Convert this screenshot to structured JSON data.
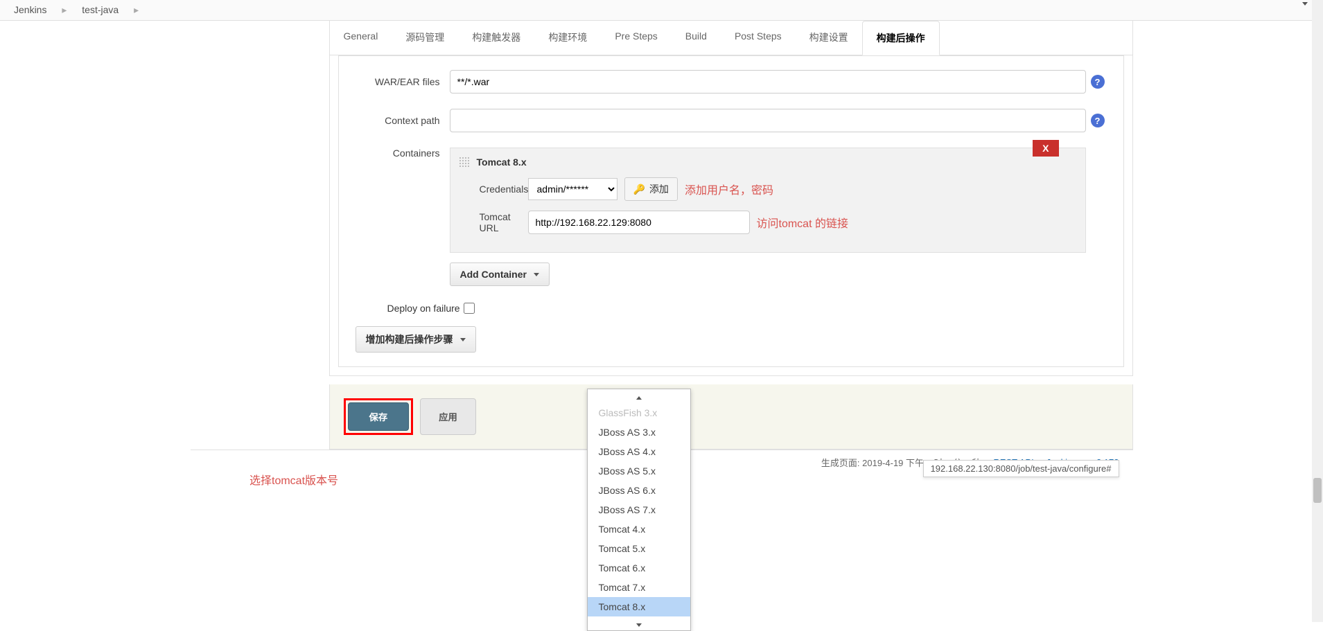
{
  "breadcrumb": {
    "root": "Jenkins",
    "job": "test-java"
  },
  "tabs": [
    "General",
    "源码管理",
    "构建触发器",
    "构建环境",
    "Pre Steps",
    "Build",
    "Post Steps",
    "构建设置",
    "构建后操作"
  ],
  "activeTab": "构建后操作",
  "form": {
    "warFilesLabel": "WAR/EAR files",
    "warFilesValue": "**/*.war",
    "contextPathLabel": "Context path",
    "contextPathValue": "",
    "containersLabel": "Containers",
    "containerTitle": "Tomcat 8.x",
    "closeLabel": "X",
    "credentialsLabel": "Credentials",
    "credentialsValue": "admin/******",
    "addCredBtn": "添加",
    "credNote": "添加用户名，密码",
    "tomcatUrlLabel": "Tomcat URL",
    "tomcatUrlValue": "http://192.168.22.129:8080",
    "urlNote": "访问tomcat 的链接",
    "addContainerBtn": "Add Container",
    "deployOnFailureLabel": "Deploy on failure",
    "addPostBuildBtn": "增加构建后操作步骤"
  },
  "dropdown": {
    "cutItem": "GlassFish 3.x",
    "items": [
      "JBoss AS 3.x",
      "JBoss AS 4.x",
      "JBoss AS 5.x",
      "JBoss AS 6.x",
      "JBoss AS 7.x",
      "Tomcat 4.x",
      "Tomcat 5.x",
      "Tomcat 6.x",
      "Tomcat 7.x",
      "Tomcat 8.x"
    ],
    "hoverIndex": 9,
    "note": "选择tomcat版本号"
  },
  "buttons": {
    "save": "保存",
    "apply": "应用"
  },
  "footer": {
    "genText": "生成页面: 2019-4-19 下午02时16分28秒",
    "restApi": "REST API",
    "version": "Jenkins ver. 2.173",
    "statusUrl": "192.168.22.130:8080/job/test-java/configure#"
  }
}
